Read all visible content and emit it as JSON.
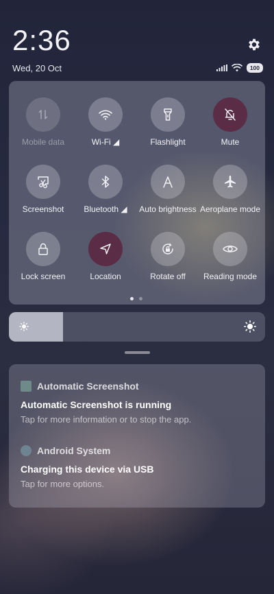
{
  "clock": {
    "time": "2:36",
    "date": "Wed, 20 Oct"
  },
  "status": {
    "battery": "100"
  },
  "quick_settings": {
    "tiles": [
      {
        "label": "Mobile data",
        "icon": "mobile-data-icon",
        "state": "disabled"
      },
      {
        "label": "Wi-Fi ◢",
        "icon": "wifi-icon",
        "state": "off"
      },
      {
        "label": "Flashlight",
        "icon": "flashlight-icon",
        "state": "off"
      },
      {
        "label": "Mute",
        "icon": "bell-off-icon",
        "state": "on"
      },
      {
        "label": "Screenshot",
        "icon": "screenshot-icon",
        "state": "off"
      },
      {
        "label": "Bluetooth ◢",
        "icon": "bluetooth-icon",
        "state": "off"
      },
      {
        "label": "Auto brightness",
        "icon": "auto-brightness-icon",
        "state": "off"
      },
      {
        "label": "Aeroplane mode",
        "icon": "airplane-icon",
        "state": "off"
      },
      {
        "label": "Lock screen",
        "icon": "lock-icon",
        "state": "off"
      },
      {
        "label": "Location",
        "icon": "location-icon",
        "state": "on"
      },
      {
        "label": "Rotate off",
        "icon": "rotate-lock-icon",
        "state": "off"
      },
      {
        "label": "Reading mode",
        "icon": "eye-icon",
        "state": "off"
      }
    ],
    "page_count": 2,
    "current_page": 1
  },
  "brightness": {
    "level": 0.21
  },
  "notifications": [
    {
      "app": "Automatic Screenshot",
      "title": "Automatic Screenshot is running",
      "text": "Tap for more information or to stop the app."
    },
    {
      "app": "Android System",
      "title": "Charging this device via USB",
      "text": "Tap for more options."
    }
  ],
  "colors": {
    "active_tile": "#5b2c46",
    "panel": "rgba(200,200,215,0.30)"
  }
}
